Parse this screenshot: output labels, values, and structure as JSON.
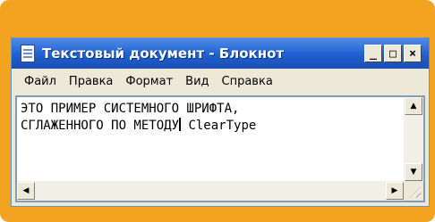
{
  "window": {
    "title": "Текстовый документ - Блокнот",
    "controls": {
      "minimize": "_",
      "maximize": "□",
      "close": "×"
    }
  },
  "menu": [
    {
      "label": "Файл"
    },
    {
      "label": "Правка"
    },
    {
      "label": "Формат"
    },
    {
      "label": "Вид"
    },
    {
      "label": "Справка"
    }
  ],
  "editor": {
    "line1": "ЭТО ПРИМЕР СИСТЕМНОГО ШРИФТА,",
    "line2_before_caret": "СГЛАЖЕННОГО ПО МЕТОДУ",
    "line2_after_caret": " ClearType"
  },
  "icons": {
    "app": "notepad-icon",
    "scroll_up": "arrow-up-icon",
    "scroll_down": "arrow-down-icon",
    "scroll_left": "arrow-left-icon",
    "scroll_right": "arrow-right-icon",
    "resize": "resize-grip-icon"
  },
  "colors": {
    "frame": "#f2a31f",
    "titlebar": "#1f5fcf",
    "window": "#ece9d8"
  }
}
